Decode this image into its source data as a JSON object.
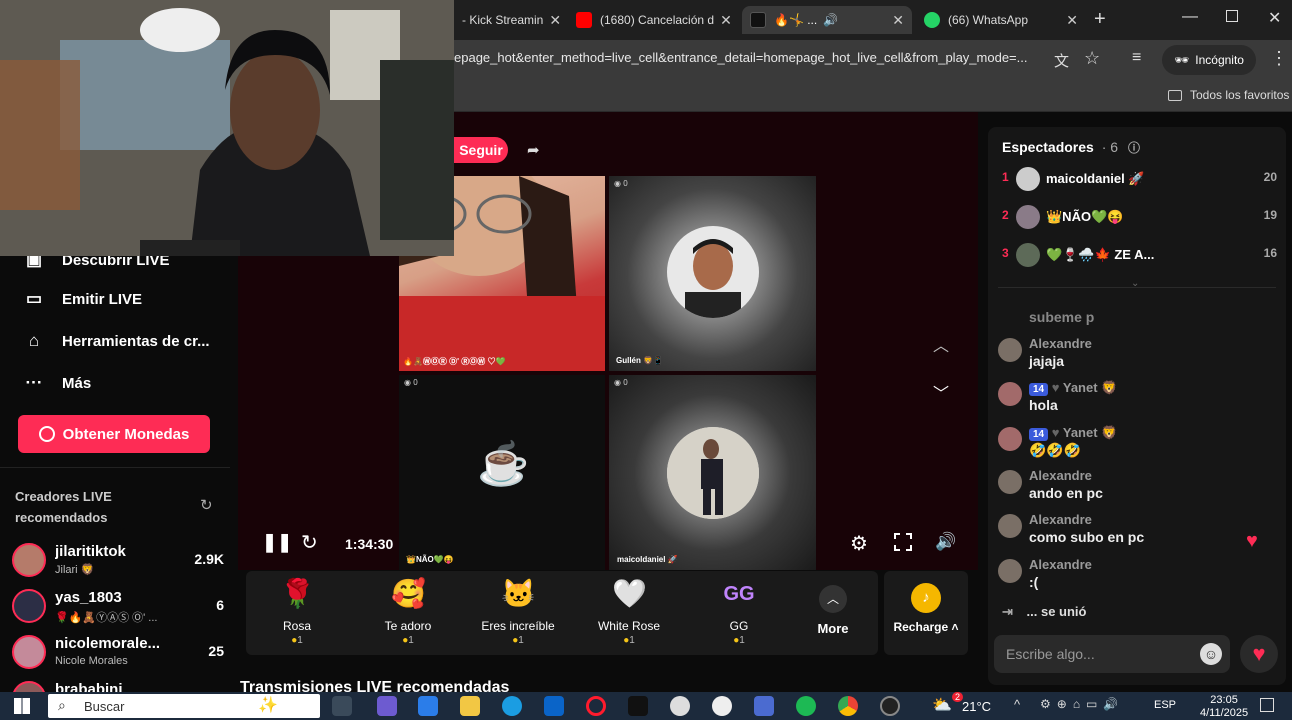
{
  "tabs": [
    {
      "label": "- Kick Streamin"
    },
    {
      "label": "(1680) Cancelación d"
    },
    {
      "label": "🔥🤸 ..."
    },
    {
      "label": "(66) WhatsApp"
    }
  ],
  "address": {
    "url": "epage_hot&enter_method=live_cell&entrance_detail=homepage_hot_live_cell&from_play_mode=...",
    "incognito": "Incógnito"
  },
  "bookmarks": {
    "all": "Todos los favoritos"
  },
  "sidebar": {
    "items": [
      {
        "label": "Descubrir LIVE"
      },
      {
        "label": "Emitir LIVE"
      },
      {
        "label": "Herramientas de cr..."
      },
      {
        "label": "Más"
      }
    ],
    "coins": "Obtener Monedas",
    "rec_title": "Creadores LIVE recomendados",
    "creators": [
      {
        "name": "jilaritiktok",
        "sub": "Jilari 🦁",
        "count": "2.9K"
      },
      {
        "name": "yas_1803",
        "sub": "🌹🔥🧸ⓎⒶⓈ Ⓞ' ...",
        "count": "6"
      },
      {
        "name": "nicolemorale...",
        "sub": "Nicole Morales",
        "count": "25"
      },
      {
        "name": "brababini",
        "sub": "",
        "count": ""
      }
    ]
  },
  "player": {
    "follow": "Seguir",
    "time": "1:34:30",
    "tiles": [
      {
        "label": "🔥🧸ⓌⓄⓇ Ⓓ' ⓇⓄⓌ ♡💚",
        "viewers": "0"
      },
      {
        "label": "Gullén 🦁📱",
        "viewers": "0"
      },
      {
        "label": "👑NÃO💚😝",
        "viewers": "0"
      },
      {
        "label": "maicoldaniel 🚀",
        "viewers": "0"
      }
    ]
  },
  "gifts": [
    {
      "name": "Rosa",
      "price": "1",
      "icon": "🌹"
    },
    {
      "name": "Te adoro",
      "price": "1",
      "icon": "🥰"
    },
    {
      "name": "Eres increíble",
      "price": "1",
      "icon": "🐱"
    },
    {
      "name": "White Rose",
      "price": "1",
      "icon": "🤍"
    },
    {
      "name": "GG",
      "price": "1",
      "icon": "GG"
    }
  ],
  "gift_more": "More",
  "recharge": "Recharge",
  "recommended_heading": "Transmisiones LIVE recomendadas",
  "viewers": {
    "title": "Espectadores",
    "count": "· 6",
    "list": [
      {
        "rank": "1",
        "name": "maicoldaniel 🚀",
        "score": "20"
      },
      {
        "rank": "2",
        "name": "👑NÃO💚😝",
        "score": "19"
      },
      {
        "rank": "3",
        "name": "💚🍷🌧️🍁 ZE A...",
        "score": "16"
      }
    ]
  },
  "chat": [
    {
      "name": "",
      "text": "subeme p",
      "badge": ""
    },
    {
      "name": "Alexandre",
      "text": "jajaja",
      "badge": ""
    },
    {
      "name": "Yanet 🦁",
      "text": "hola",
      "badge": "14"
    },
    {
      "name": "Yanet 🦁",
      "text": "🤣🤣🤣",
      "badge": "14"
    },
    {
      "name": "Alexandre",
      "text": "ando en pc",
      "badge": ""
    },
    {
      "name": "Alexandre",
      "text": "como subo en pc",
      "badge": ""
    },
    {
      "name": "Alexandre",
      "text": ":(",
      "badge": ""
    }
  ],
  "joined": "... se unió",
  "chat_input_placeholder": "Escribe algo...",
  "taskbar": {
    "search": "Buscar",
    "weather": "21°C",
    "lang": "ESP",
    "time": "23:05",
    "date": "4/11/2025",
    "weather_badge": "2"
  },
  "colors": {
    "accent": "#fe2c55"
  }
}
